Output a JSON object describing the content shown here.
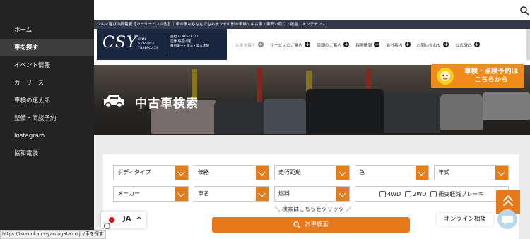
{
  "sidebar": {
    "items": [
      {
        "label": "ホーム"
      },
      {
        "label": "車を探す"
      },
      {
        "label": "イベント情報"
      },
      {
        "label": "カーリース"
      },
      {
        "label": "車検の速太郎"
      },
      {
        "label": "整備・商談予約"
      },
      {
        "label": "Instagram"
      },
      {
        "label": "協和電装"
      }
    ],
    "active_index": 1
  },
  "tagline": "クルマ選びの終着駅【カーサービス山形】｜車の事ならなんでもおまかせ山形の車検・中古車・車買い取り・鈑金・メンテナンス",
  "logo": {
    "name": "CSY",
    "sub": "CAR SERVICE YAMAGATA",
    "hours": "受付 9:30～18:00",
    "closed": "定休 毎週火曜",
    "closed2": "毎月第一・第三・第三水曜"
  },
  "nav": {
    "items": [
      {
        "label": "お車を探す"
      },
      {
        "label": "サービスのご案内"
      },
      {
        "label": "店舗のご案内"
      },
      {
        "label": "採用情報"
      },
      {
        "label": "会社案内"
      },
      {
        "label": "お問い合わせ"
      },
      {
        "label": "公式SNS"
      }
    ]
  },
  "hero": {
    "title": "中古車検索"
  },
  "promo": {
    "line1": "車検・点検予約は",
    "line2": "こちらから"
  },
  "search": {
    "row1": [
      "ボディタイプ",
      "価格",
      "走行距離",
      "色",
      "年式"
    ],
    "row2": [
      "メーカー",
      "車名",
      "燃料"
    ],
    "checkboxes": [
      "4WD",
      "2WD",
      "衝突軽減ブレーキ"
    ],
    "hint": "＼ 検索はこちらをクリック ／",
    "button": "お車検索"
  },
  "lang": {
    "code": "JA"
  },
  "chat": {
    "label": "オンライン相談"
  },
  "status_url": "https://tsuruoka.cs-yamagata.co.jp/車を探す",
  "colors": {
    "accent": "#e8791a",
    "sidebar": "#232323",
    "brand_navy": "#1a2540"
  }
}
